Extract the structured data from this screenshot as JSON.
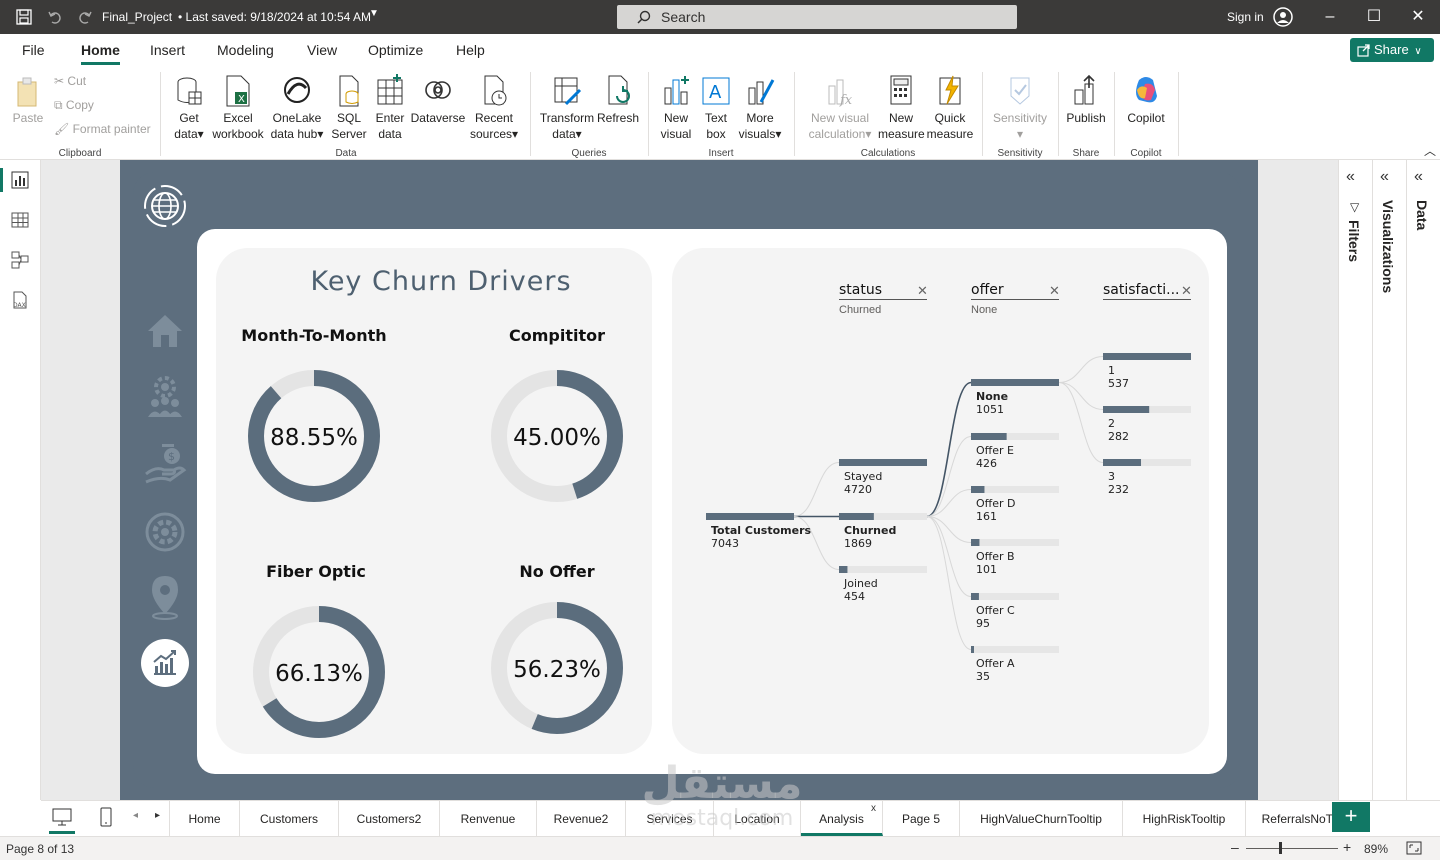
{
  "titlebar": {
    "file_name": "Final_Project",
    "saved": "• Last saved: 9/18/2024 at 10:54 AM",
    "search_placeholder": "Search",
    "sign_in": "Sign in"
  },
  "menu": {
    "items": [
      "File",
      "Home",
      "Insert",
      "Modeling",
      "View",
      "Optimize",
      "Help"
    ],
    "active": "Home",
    "share_label": "Share"
  },
  "ribbon": {
    "clipboard": {
      "paste": "Paste",
      "cut": "Cut",
      "copy": "Copy",
      "format_painter": "Format painter",
      "group": "Clipboard"
    },
    "data": {
      "get_data": [
        "Get",
        "data"
      ],
      "excel": [
        "Excel",
        "workbook"
      ],
      "onelake": [
        "OneLake",
        "data hub"
      ],
      "sql": [
        "SQL",
        "Server"
      ],
      "enter": [
        "Enter",
        "data"
      ],
      "dataverse": [
        "Dataverse",
        ""
      ],
      "recent": [
        "Recent",
        "sources"
      ],
      "group": "Data"
    },
    "queries": {
      "transform": [
        "Transform",
        "data"
      ],
      "refresh": [
        "Refresh",
        ""
      ],
      "group": "Queries"
    },
    "insert": {
      "new_visual": [
        "New",
        "visual"
      ],
      "text_box": [
        "Text",
        "box"
      ],
      "more_visuals": [
        "More",
        "visuals"
      ],
      "group": "Insert"
    },
    "calculations": {
      "new_visual_calc": [
        "New visual",
        "calculation"
      ],
      "new_measure": [
        "New",
        "measure"
      ],
      "quick_measure": [
        "Quick",
        "measure"
      ],
      "group": "Calculations"
    },
    "sensitivity": {
      "label": "Sensitivity",
      "group": "Sensitivity"
    },
    "share": {
      "publish": "Publish",
      "group": "Share"
    },
    "copilot": {
      "label": "Copilot",
      "group": "Copilot"
    }
  },
  "report": {
    "title": "Key Churn Drivers",
    "donuts": [
      {
        "label": "Month-To-Month",
        "value": 88.55,
        "text": "88.55%"
      },
      {
        "label": "Compititor",
        "value": 45.0,
        "text": "45.00%"
      },
      {
        "label": "Fiber Optic",
        "value": 66.13,
        "text": "66.13%"
      },
      {
        "label": "No Offer",
        "value": 56.23,
        "text": "56.23%"
      }
    ],
    "colors": {
      "ring": "#5b6d7d",
      "track": "#e4e4e4",
      "panel": "#5d6e7e"
    },
    "decomposition": {
      "filters": [
        {
          "name": "status",
          "value": "Churned"
        },
        {
          "name": "offer",
          "value": "None"
        },
        {
          "name": "satisfacti...",
          "value": ""
        }
      ],
      "root": {
        "label": "Total Customers",
        "value": "7043"
      },
      "level1": [
        {
          "label": "Stayed",
          "value": "4720",
          "fraction": 1.0
        },
        {
          "label": "Churned",
          "value": "1869",
          "fraction": 0.396
        },
        {
          "label": "Joined",
          "value": "454",
          "fraction": 0.096
        }
      ],
      "level2": [
        {
          "label": "None",
          "value": "1051",
          "fraction": 1.0
        },
        {
          "label": "Offer E",
          "value": "426",
          "fraction": 0.405
        },
        {
          "label": "Offer D",
          "value": "161",
          "fraction": 0.153
        },
        {
          "label": "Offer B",
          "value": "101",
          "fraction": 0.096
        },
        {
          "label": "Offer C",
          "value": "95",
          "fraction": 0.09
        },
        {
          "label": "Offer A",
          "value": "35",
          "fraction": 0.033
        }
      ],
      "level3": [
        {
          "label": "1",
          "value": "537",
          "fraction": 1.0
        },
        {
          "label": "2",
          "value": "282",
          "fraction": 0.525
        },
        {
          "label": "3",
          "value": "232",
          "fraction": 0.432
        }
      ]
    }
  },
  "panes": {
    "filters": "Filters",
    "visualizations": "Visualizations",
    "data": "Data"
  },
  "tabs": {
    "items": [
      "Home",
      "Customers",
      "Customers2",
      "Renvenue",
      "Revenue2",
      "Services",
      "Location",
      "Analysis",
      "Page 5",
      "HighValueChurnTooltip",
      "HighRiskTooltip",
      "ReferralsNoT"
    ],
    "active": "Analysis"
  },
  "status": {
    "page": "Page 8 of 13",
    "zoom": "89%"
  },
  "watermark": {
    "arabic": "مستقل",
    "latin": "mostaql.com"
  }
}
